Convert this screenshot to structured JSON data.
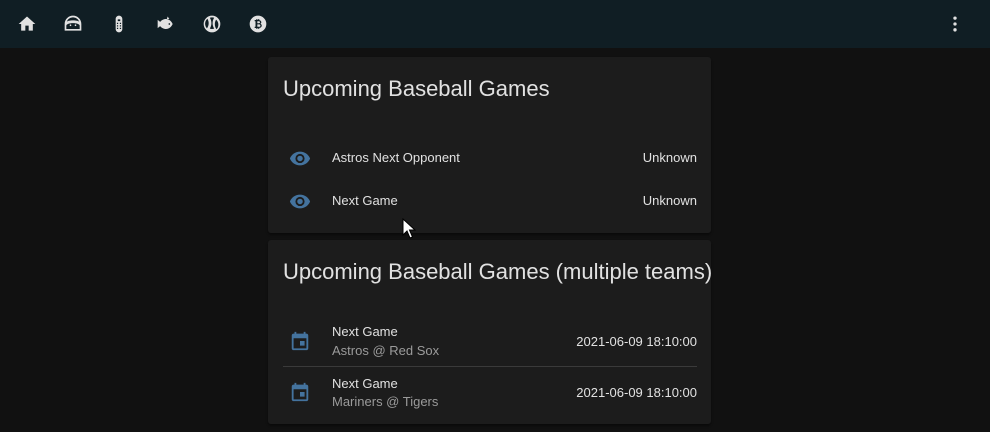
{
  "toolbar": {
    "tabs": [
      {
        "icon": "home-icon"
      },
      {
        "icon": "face-icon"
      },
      {
        "icon": "remote-icon"
      },
      {
        "icon": "fish-icon"
      },
      {
        "icon": "baseball-icon"
      },
      {
        "icon": "bitcoin-icon"
      }
    ],
    "menu_icon": "dots-vertical-icon"
  },
  "cards": [
    {
      "title": "Upcoming Baseball Games",
      "rows": [
        {
          "icon": "eye-icon",
          "name": "Astros Next Opponent",
          "state": "Unknown"
        },
        {
          "icon": "eye-icon",
          "name": "Next Game",
          "state": "Unknown"
        }
      ]
    },
    {
      "title": "Upcoming Baseball Games (multiple teams)",
      "rows": [
        {
          "icon": "calendar-icon",
          "name": "Next Game",
          "secondary": "Astros @ Red Sox",
          "state": "2021-06-09 18:10:00"
        },
        {
          "icon": "calendar-icon",
          "name": "Next Game",
          "secondary": "Mariners @ Tigers",
          "state": "2021-06-09 18:10:00"
        }
      ]
    }
  ],
  "colors": {
    "background": "#111111",
    "toolbar": "#101e24",
    "card": "#1c1c1c",
    "icon_accent": "#44739e",
    "primary_text": "#e1e1e1",
    "secondary_text": "#9b9b9b"
  }
}
